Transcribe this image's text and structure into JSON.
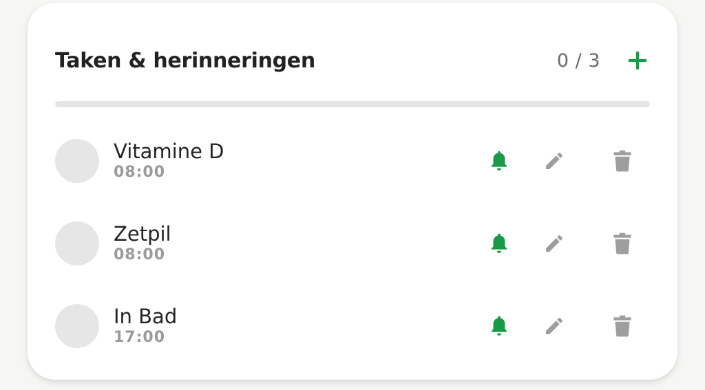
{
  "panel": {
    "title": "Taken & herinneringen",
    "counter": "0 / 3",
    "progress_fraction": 0.0
  },
  "colors": {
    "accent": "#1a9a46",
    "icon_gray": "#9e9e9e",
    "check_bg": "#e6e6e6"
  },
  "icons": {
    "add": "plus-icon",
    "reminder": "bell-icon",
    "edit": "pencil-icon",
    "delete": "trash-icon"
  },
  "tasks": [
    {
      "name": "Vitamine D",
      "time": "08:00",
      "done": false,
      "reminder": true
    },
    {
      "name": "Zetpil",
      "time": "08:00",
      "done": false,
      "reminder": true
    },
    {
      "name": "In Bad",
      "time": "17:00",
      "done": false,
      "reminder": true
    }
  ]
}
